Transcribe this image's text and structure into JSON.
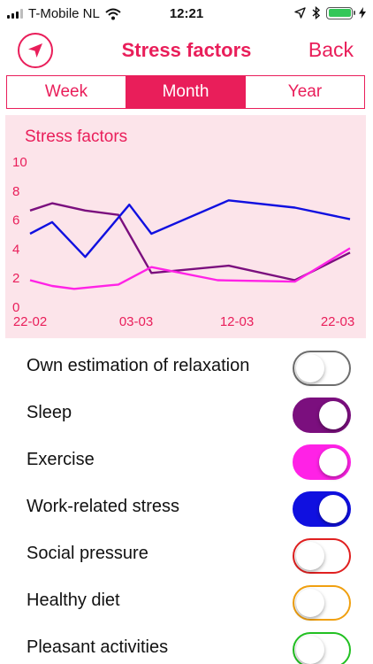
{
  "status_bar": {
    "carrier": "T-Mobile NL",
    "time": "12:21",
    "icons": [
      "signal-icon",
      "wifi-icon",
      "location-arrow-icon",
      "bluetooth-icon",
      "battery-icon",
      "charging-bolt-icon"
    ],
    "battery_color": "#34c759"
  },
  "nav": {
    "title": "Stress factors",
    "back_label": "Back",
    "left_icon": "location-arrow-icon",
    "accent_color": "#e91e5a"
  },
  "segments": {
    "items": [
      {
        "label": "Week",
        "selected": false
      },
      {
        "label": "Month",
        "selected": true
      },
      {
        "label": "Year",
        "selected": false
      }
    ]
  },
  "chart_data": {
    "type": "line",
    "title": "Stress factors",
    "ylim": [
      0,
      10
    ],
    "yticks": [
      "0",
      "2",
      "4",
      "6",
      "8",
      "10"
    ],
    "xticks": [
      "22-02",
      "03-03",
      "12-03",
      "22-03"
    ],
    "grid": false,
    "background": "#fce4ea",
    "series": [
      {
        "color": "#7b0f7e",
        "points": [
          [
            0,
            6.6
          ],
          [
            1,
            7.1
          ],
          [
            2.5,
            6.6
          ],
          [
            4,
            6.3
          ],
          [
            5.5,
            2.3
          ],
          [
            9,
            2.8
          ],
          [
            12,
            1.8
          ],
          [
            14.5,
            3.7
          ]
        ]
      },
      {
        "color": "#ff22e6",
        "points": [
          [
            0,
            1.8
          ],
          [
            1,
            1.4
          ],
          [
            2,
            1.2
          ],
          [
            4,
            1.5
          ],
          [
            5.5,
            2.7
          ],
          [
            8.5,
            1.8
          ],
          [
            12,
            1.7
          ],
          [
            14.5,
            4.0
          ]
        ]
      },
      {
        "color": "#1010e0",
        "points": [
          [
            0,
            5.0
          ],
          [
            1,
            5.8
          ],
          [
            2.5,
            3.4
          ],
          [
            4.5,
            7.0
          ],
          [
            5.5,
            5.0
          ],
          [
            9,
            7.3
          ],
          [
            12,
            6.8
          ],
          [
            14.5,
            6.0
          ]
        ]
      }
    ]
  },
  "factors": [
    {
      "label": "Own estimation of relaxation",
      "on": false,
      "color": "#6e6e6e"
    },
    {
      "label": "Sleep",
      "on": true,
      "color": "#7b0f7e"
    },
    {
      "label": "Exercise",
      "on": true,
      "color": "#ff22e6"
    },
    {
      "label": "Work-related stress",
      "on": true,
      "color": "#1010e0"
    },
    {
      "label": "Social pressure",
      "on": false,
      "color": "#e02020"
    },
    {
      "label": "Healthy diet",
      "on": false,
      "color": "#f0a010"
    },
    {
      "label": "Pleasant activities",
      "on": false,
      "color": "#22c022"
    }
  ]
}
